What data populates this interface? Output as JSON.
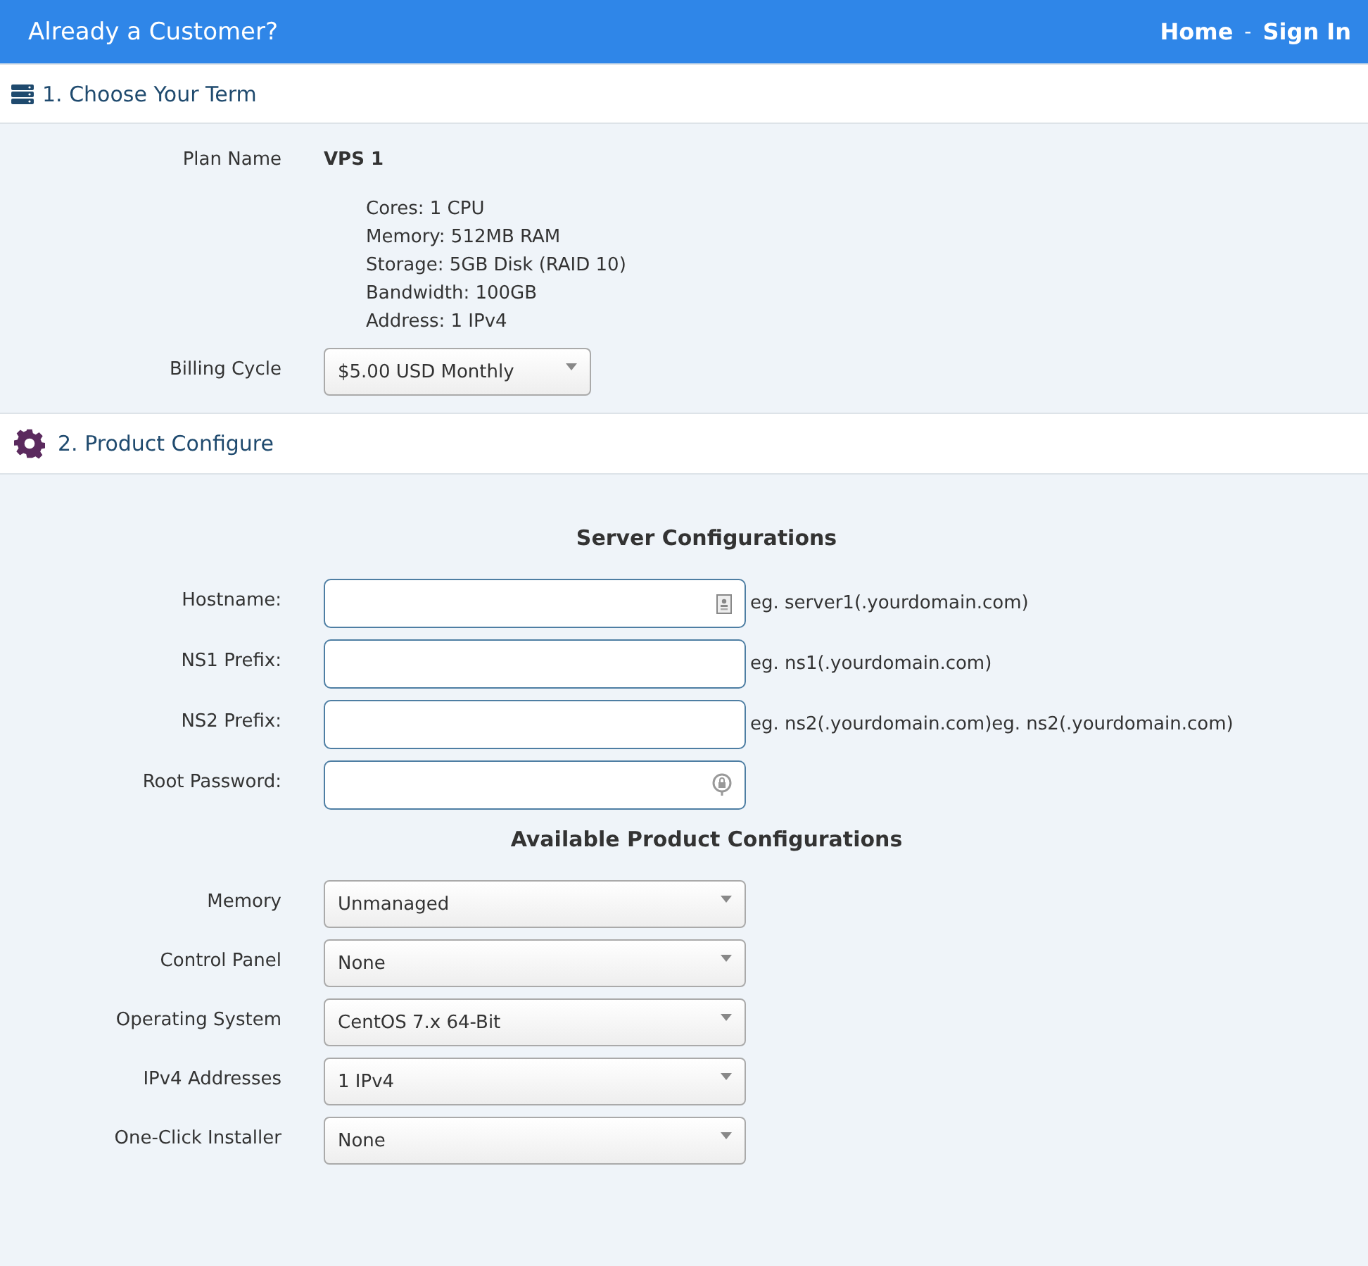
{
  "header": {
    "title": "Already a Customer?",
    "links": [
      "Home",
      "Sign In"
    ],
    "separator": "-"
  },
  "term_section": {
    "title": "1. Choose Your Term",
    "plan_label": "Plan Name",
    "plan_name": "VPS 1",
    "plan_details": [
      "Cores: 1 CPU",
      "Memory: 512MB RAM",
      "Storage: 5GB Disk (RAID 10)",
      "Bandwidth: 100GB",
      "Address: 1 IPv4"
    ],
    "billing_label": "Billing Cycle",
    "billing_value": "$5.00 USD Monthly"
  },
  "configure_section": {
    "title": "2. Product Configure",
    "server_heading": "Server Configurations",
    "fields": [
      {
        "label": "Hostname:",
        "kind": "contact",
        "hint": "eg. server1(.yourdomain.com)"
      },
      {
        "label": "NS1 Prefix:",
        "kind": "plain",
        "hint": "eg. ns1(.yourdomain.com)"
      },
      {
        "label": "NS2 Prefix:",
        "kind": "plain",
        "hint": "eg. ns2(.yourdomain.com)eg. ns2(.yourdomain.com)"
      },
      {
        "label": "Root Password:",
        "kind": "password"
      }
    ],
    "options_heading": "Available Product Configurations",
    "options": [
      {
        "label": "Memory",
        "value": "Unmanaged"
      },
      {
        "label": "Control Panel",
        "value": "None"
      },
      {
        "label": "Operating System",
        "value": "CentOS 7.x 64-Bit"
      },
      {
        "label": "IPv4 Addresses",
        "value": "1 IPv4"
      },
      {
        "label": "One-Click Installer",
        "value": "None"
      }
    ]
  }
}
